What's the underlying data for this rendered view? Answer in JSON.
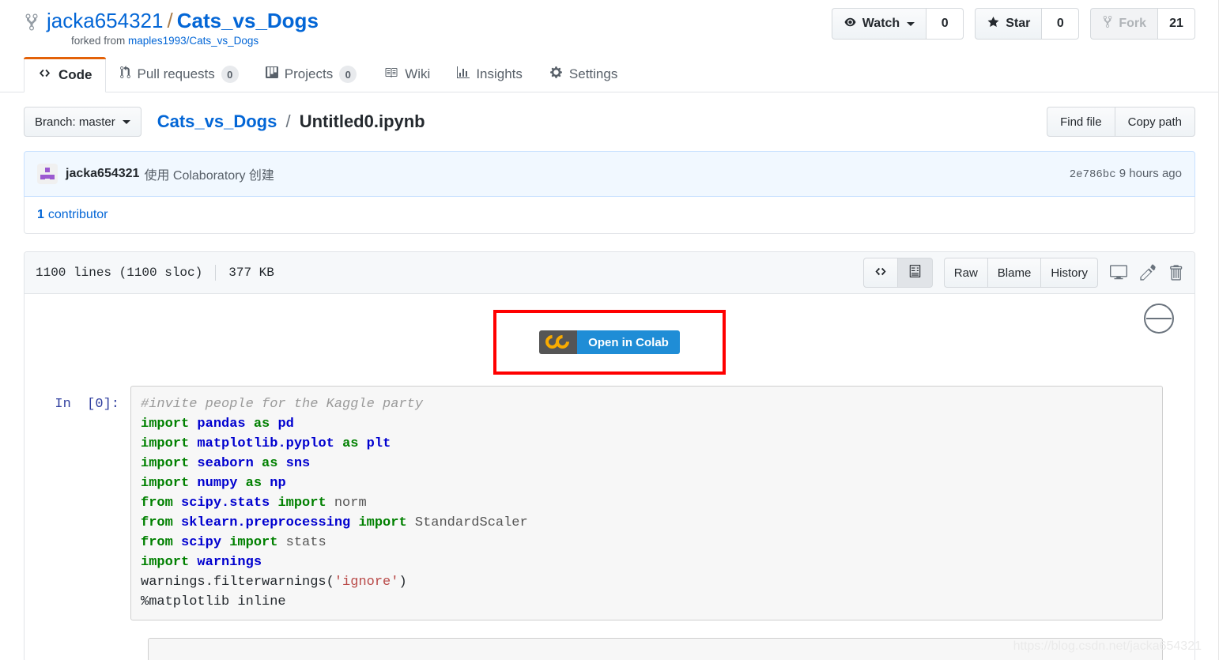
{
  "repo": {
    "owner": "jacka654321",
    "separator": "/",
    "name": "Cats_vs_Dogs",
    "forked_from_label": "forked from",
    "forked_from_repo": "maples1993/Cats_vs_Dogs",
    "fork_icon": "fork-icon"
  },
  "actions": {
    "watch": {
      "label": "Watch",
      "count": "0",
      "icon": "eye-icon",
      "has_caret": true
    },
    "star": {
      "label": "Star",
      "count": "0",
      "icon": "star-icon"
    },
    "fork": {
      "label": "Fork",
      "count": "21",
      "icon": "fork-icon",
      "disabled": true
    }
  },
  "tabs": [
    {
      "label": "Code",
      "icon": "code-icon",
      "active": true,
      "count": null
    },
    {
      "label": "Pull requests",
      "icon": "git-pull-request-icon",
      "active": false,
      "count": "0"
    },
    {
      "label": "Projects",
      "icon": "project-board-icon",
      "active": false,
      "count": "0"
    },
    {
      "label": "Wiki",
      "icon": "book-icon",
      "active": false,
      "count": null
    },
    {
      "label": "Insights",
      "icon": "graph-icon",
      "active": false,
      "count": null
    },
    {
      "label": "Settings",
      "icon": "gear-icon",
      "active": false,
      "count": null
    }
  ],
  "file_nav": {
    "branch_label": "Branch: master",
    "breadcrumb_repo": "Cats_vs_Dogs",
    "breadcrumb_sep": "/",
    "breadcrumb_file": "Untitled0.ipynb",
    "find_file": "Find file",
    "copy_path": "Copy path"
  },
  "commit": {
    "author": "jacka654321",
    "message": "使用 Colaboratory 创建",
    "sha": "2e786bc",
    "time": "9 hours ago",
    "contributors_count": "1",
    "contributors_label": "contributor"
  },
  "file_header": {
    "lines": "1100 lines (1100 sloc)",
    "size": "377 KB",
    "view_source_icon": "code-icon",
    "view_rendered_icon": "file-icon",
    "raw": "Raw",
    "blame": "Blame",
    "history": "History",
    "desktop_icon": "desktop-download-icon",
    "edit_icon": "pencil-icon",
    "delete_icon": "trash-icon"
  },
  "notebook": {
    "colab_badge_logo": "CO",
    "colab_badge_label": "Open in Colab",
    "collapse_icon": "circle-minus-icon",
    "prompt": "In  [0]:",
    "code_lines": [
      [
        {
          "t": "#invite people for the Kaggle party",
          "c": "c"
        }
      ],
      [
        {
          "t": "import ",
          "c": "k"
        },
        {
          "t": "pandas ",
          "c": "n"
        },
        {
          "t": "as ",
          "c": "k"
        },
        {
          "t": "pd",
          "c": "n"
        }
      ],
      [
        {
          "t": "import ",
          "c": "k"
        },
        {
          "t": "matplotlib.pyplot ",
          "c": "n"
        },
        {
          "t": "as ",
          "c": "k"
        },
        {
          "t": "plt",
          "c": "n"
        }
      ],
      [
        {
          "t": "import ",
          "c": "k"
        },
        {
          "t": "seaborn ",
          "c": "n"
        },
        {
          "t": "as ",
          "c": "k"
        },
        {
          "t": "sns",
          "c": "n"
        }
      ],
      [
        {
          "t": "import ",
          "c": "k"
        },
        {
          "t": "numpy ",
          "c": "n"
        },
        {
          "t": "as ",
          "c": "k"
        },
        {
          "t": "np",
          "c": "n"
        }
      ],
      [
        {
          "t": "from ",
          "c": "k"
        },
        {
          "t": "scipy.stats ",
          "c": "n"
        },
        {
          "t": "import ",
          "c": "k"
        },
        {
          "t": "norm",
          "c": "m"
        }
      ],
      [
        {
          "t": "from ",
          "c": "k"
        },
        {
          "t": "sklearn.preprocessing ",
          "c": "n"
        },
        {
          "t": "import ",
          "c": "k"
        },
        {
          "t": "StandardScaler",
          "c": "m"
        }
      ],
      [
        {
          "t": "from ",
          "c": "k"
        },
        {
          "t": "scipy ",
          "c": "n"
        },
        {
          "t": "import ",
          "c": "k"
        },
        {
          "t": "stats",
          "c": "m"
        }
      ],
      [
        {
          "t": "import ",
          "c": "k"
        },
        {
          "t": "warnings",
          "c": "n"
        }
      ],
      [
        {
          "t": "warnings.filterwarnings(",
          "c": "p"
        },
        {
          "t": "'ignore'",
          "c": "s"
        },
        {
          "t": ")",
          "c": "p"
        }
      ],
      [
        {
          "t": "%matplotlib inline",
          "c": "p"
        }
      ]
    ]
  },
  "watermark": "https://blog.csdn.net/jacka654321",
  "colors": {
    "link": "#0366d6",
    "accent_orange": "#e36209",
    "commit_bg": "#f1f8ff",
    "border": "#e1e4e8",
    "highlight_red": "#ff0000",
    "colab_blue": "#1f8dd6",
    "colab_gray": "#555555",
    "colab_orange": "#f9ab00"
  }
}
